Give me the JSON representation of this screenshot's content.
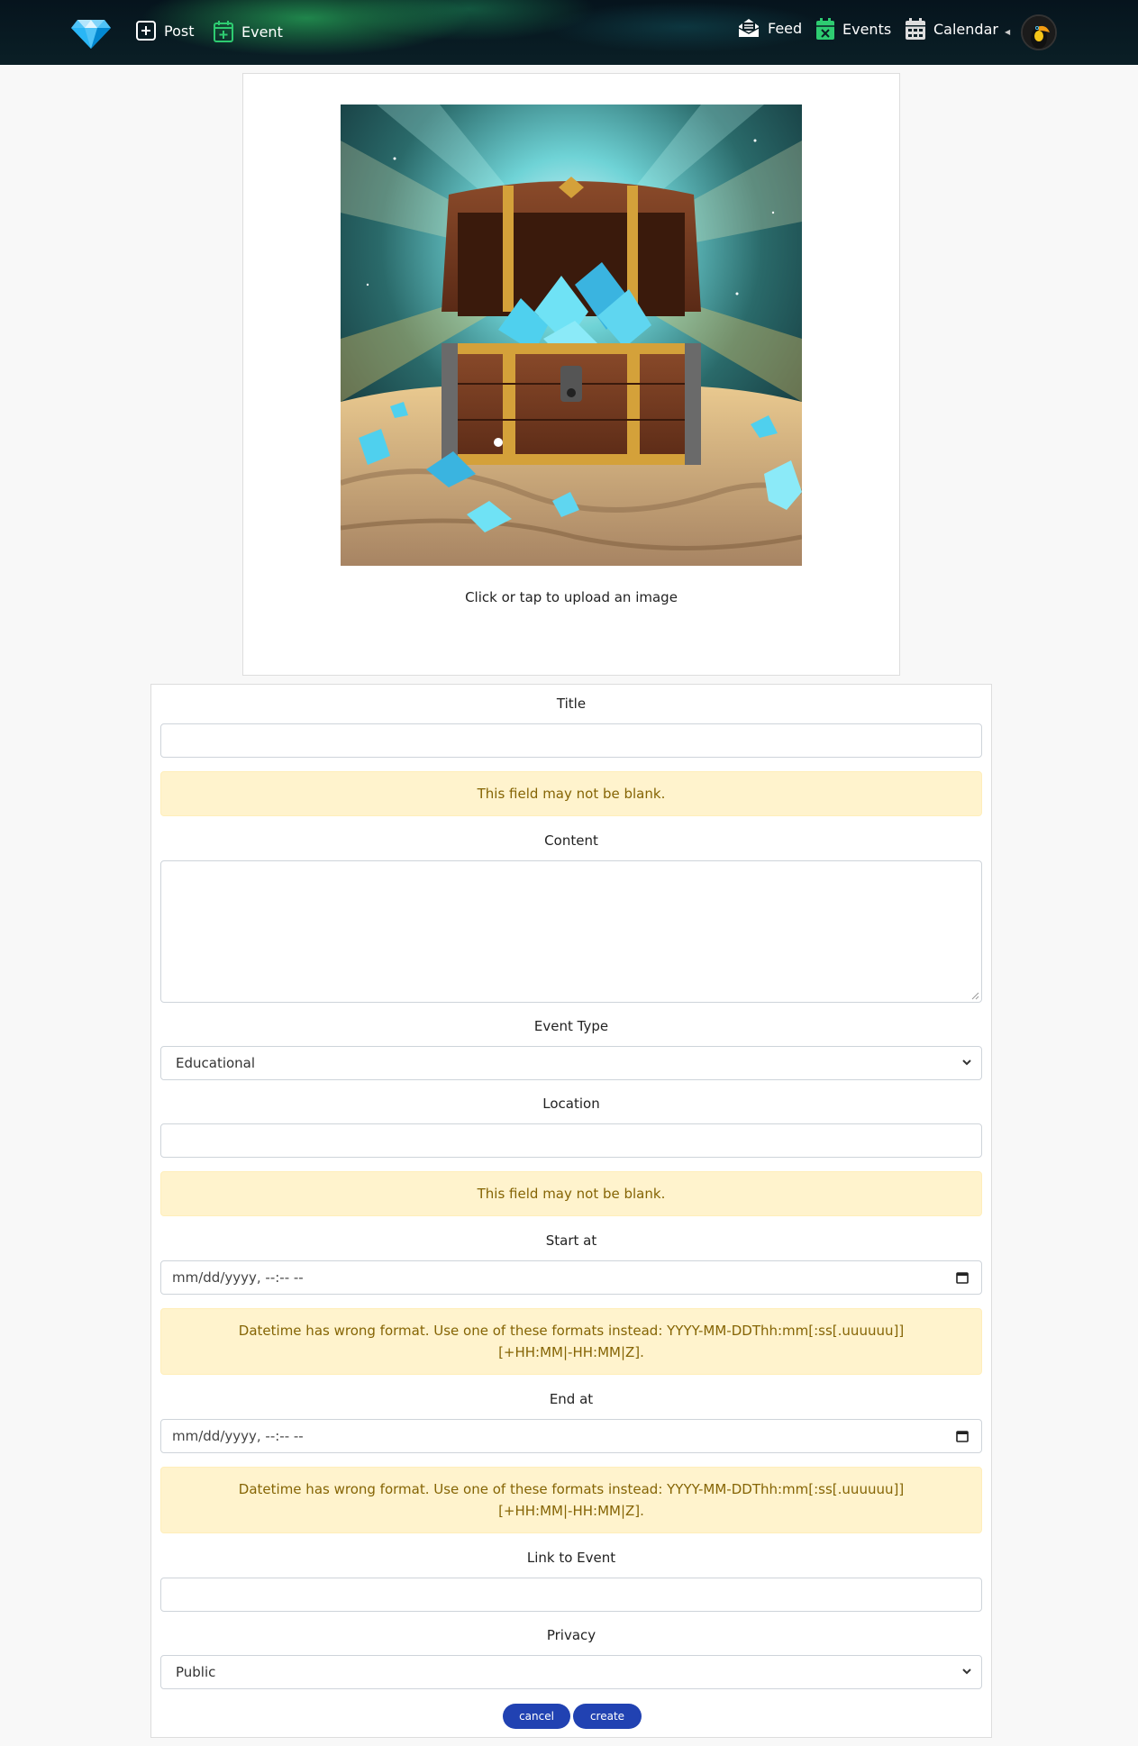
{
  "navbar": {
    "post_label": "Post",
    "event_label": "Event",
    "feed_label": "Feed",
    "events_label": "Events",
    "calendar_label": "Calendar"
  },
  "upload": {
    "label": "Click or tap to upload an image"
  },
  "form": {
    "title_label": "Title",
    "title_value": "",
    "title_error": "This field may not be blank.",
    "content_label": "Content",
    "content_value": "",
    "event_type_label": "Event Type",
    "event_type_value": "Educational",
    "location_label": "Location",
    "location_value": "",
    "location_error": "This field may not be blank.",
    "start_label": "Start at",
    "start_placeholder": "mm/dd/yyyy, --:-- --",
    "start_error": "Datetime has wrong format. Use one of these formats instead: YYYY-MM-DDThh:mm[:ss[.uuuuuu]][+HH:MM|-HH:MM|Z].",
    "end_label": "End at",
    "end_placeholder": "mm/dd/yyyy, --:-- --",
    "end_error": "Datetime has wrong format. Use one of these formats instead: YYYY-MM-DDThh:mm[:ss[.uuuuuu]][+HH:MM|-HH:MM|Z].",
    "link_label": "Link to Event",
    "link_value": "",
    "privacy_label": "Privacy",
    "privacy_value": "Public",
    "cancel_label": "cancel",
    "create_label": "create"
  },
  "colors": {
    "accent": "#2142b2",
    "alert_bg": "#fff3cd",
    "alert_text": "#856404",
    "nav_green": "#2ecc71"
  }
}
